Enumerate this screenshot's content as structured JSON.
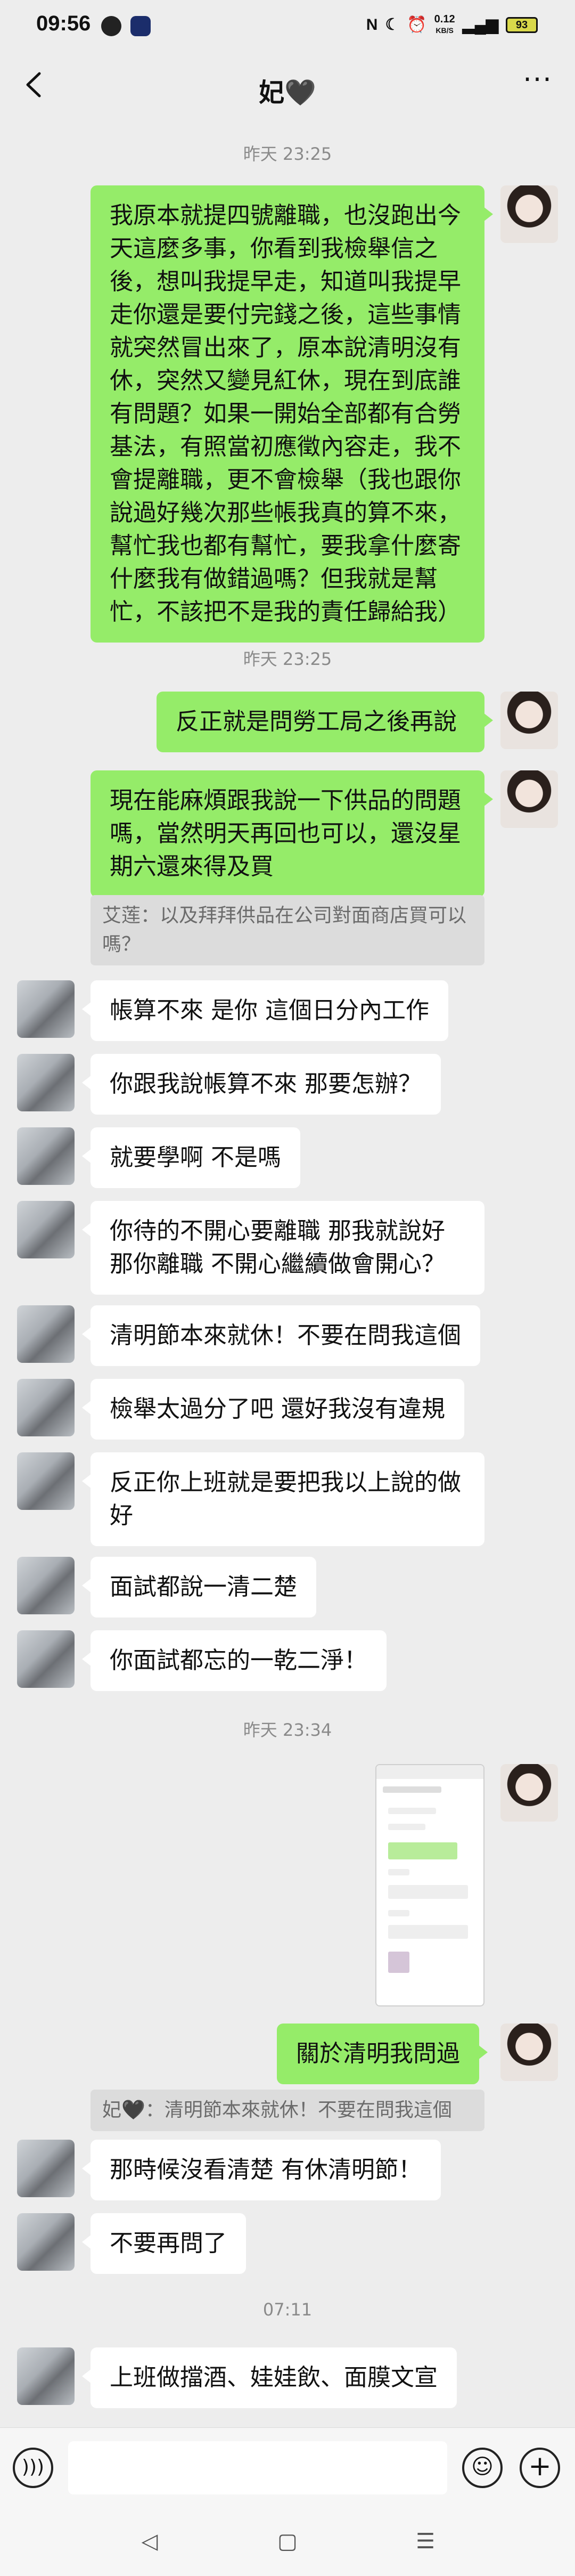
{
  "status_bar": {
    "time": "09:56",
    "net_speed": "0.12",
    "net_unit": "KB/S",
    "battery": "93",
    "icons": [
      "app-notification-icon",
      "app-notification-icon",
      "nfc-icon",
      "moon-icon",
      "alarm-icon",
      "signal-icon"
    ]
  },
  "header": {
    "title": "妃🖤",
    "back_icon": "chevron-left-icon",
    "more_icon": "more-dots-icon",
    "more_text": "···"
  },
  "timestamps": [
    "昨天 23:25",
    "昨天 23:25",
    "昨天 23:34",
    "07:11"
  ],
  "messages": [
    {
      "side": "me",
      "text": "我原本就提四號離職，也沒跑出今天這麼多事，你看到我檢舉信之後，想叫我提早走，知道叫我提早走你還是要付完錢之後，這些事情就突然冒出來了，原本說清明沒有休，突然又變見紅休，現在到底誰有問題？如果一開始全部都有合勞基法，有照當初應徵內容走，我不會提離職，更不會檢舉（我也跟你說過好幾次那些帳我真的算不來，幫忙我也都有幫忙，要我拿什麼寄什麼我有做錯過嗎？但我就是幫忙，不該把不是我的責任歸給我）"
    },
    {
      "side": "me",
      "text": "反正就是問勞工局之後再說"
    },
    {
      "side": "me",
      "text": "現在能麻煩跟我說一下供品的問題嗎，當然明天再回也可以，還沒星期六還來得及買"
    },
    {
      "side": "other",
      "text": "帳算不來 是你 這個日分內工作"
    },
    {
      "side": "other",
      "text": "你跟我說帳算不來 那要怎辦？"
    },
    {
      "side": "other",
      "text": "就要學啊 不是嗎"
    },
    {
      "side": "other",
      "text": "你待的不開心要離職 那我就說好那你離職 不開心繼續做會開心？"
    },
    {
      "side": "other",
      "text": "清明節本來就休！不要在問我這個"
    },
    {
      "side": "other",
      "text": "檢舉太過分了吧 還好我沒有違規"
    },
    {
      "side": "other",
      "text": "反正你上班就是要把我以上說的做好"
    },
    {
      "side": "other",
      "text": "面試都說一清二楚"
    },
    {
      "side": "other",
      "text": "你面試都忘的一乾二淨！"
    },
    {
      "side": "me",
      "text": "關於清明我問過"
    },
    {
      "side": "other",
      "text": "那時候沒看清楚 有休清明節！"
    },
    {
      "side": "other",
      "text": "不要再問了"
    },
    {
      "side": "other",
      "text": "上班做擋酒、娃娃飲、面膜文宣"
    }
  ],
  "quotes": [
    "艾莲：以及拜拜供品在公司對面商店買可以嗎？",
    "妃🖤：清明節本來就休！不要在問我這個"
  ],
  "input_bar": {
    "placeholder": "",
    "voice_icon": "voice-icon",
    "emoji_icon": "emoji-icon",
    "plus_icon": "plus-icon"
  },
  "nav_bar": {
    "back": "◁",
    "home": "▢",
    "recents": "☰"
  },
  "colors": {
    "background": "#ededed",
    "my_bubble": "#95ec69",
    "their_bubble": "#ffffff",
    "timestamp": "#8a8a8a"
  }
}
